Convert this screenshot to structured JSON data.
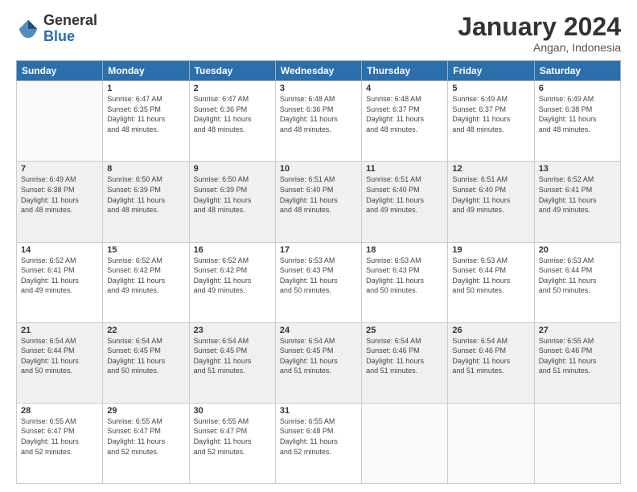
{
  "logo": {
    "general": "General",
    "blue": "Blue"
  },
  "header": {
    "month": "January 2024",
    "location": "Angan, Indonesia"
  },
  "weekdays": [
    "Sunday",
    "Monday",
    "Tuesday",
    "Wednesday",
    "Thursday",
    "Friday",
    "Saturday"
  ],
  "rows": [
    [
      {
        "day": "",
        "empty": true
      },
      {
        "day": "1",
        "sunrise": "Sunrise: 6:47 AM",
        "sunset": "Sunset: 6:35 PM",
        "daylight": "Daylight: 11 hours and 48 minutes."
      },
      {
        "day": "2",
        "sunrise": "Sunrise: 6:47 AM",
        "sunset": "Sunset: 6:36 PM",
        "daylight": "Daylight: 11 hours and 48 minutes."
      },
      {
        "day": "3",
        "sunrise": "Sunrise: 6:48 AM",
        "sunset": "Sunset: 6:36 PM",
        "daylight": "Daylight: 11 hours and 48 minutes."
      },
      {
        "day": "4",
        "sunrise": "Sunrise: 6:48 AM",
        "sunset": "Sunset: 6:37 PM",
        "daylight": "Daylight: 11 hours and 48 minutes."
      },
      {
        "day": "5",
        "sunrise": "Sunrise: 6:49 AM",
        "sunset": "Sunset: 6:37 PM",
        "daylight": "Daylight: 11 hours and 48 minutes."
      },
      {
        "day": "6",
        "sunrise": "Sunrise: 6:49 AM",
        "sunset": "Sunset: 6:38 PM",
        "daylight": "Daylight: 11 hours and 48 minutes."
      }
    ],
    [
      {
        "day": "7",
        "sunrise": "Sunrise: 6:49 AM",
        "sunset": "Sunset: 6:38 PM",
        "daylight": "Daylight: 11 hours and 48 minutes."
      },
      {
        "day": "8",
        "sunrise": "Sunrise: 6:50 AM",
        "sunset": "Sunset: 6:39 PM",
        "daylight": "Daylight: 11 hours and 48 minutes."
      },
      {
        "day": "9",
        "sunrise": "Sunrise: 6:50 AM",
        "sunset": "Sunset: 6:39 PM",
        "daylight": "Daylight: 11 hours and 48 minutes."
      },
      {
        "day": "10",
        "sunrise": "Sunrise: 6:51 AM",
        "sunset": "Sunset: 6:40 PM",
        "daylight": "Daylight: 11 hours and 48 minutes."
      },
      {
        "day": "11",
        "sunrise": "Sunrise: 6:51 AM",
        "sunset": "Sunset: 6:40 PM",
        "daylight": "Daylight: 11 hours and 49 minutes."
      },
      {
        "day": "12",
        "sunrise": "Sunrise: 6:51 AM",
        "sunset": "Sunset: 6:40 PM",
        "daylight": "Daylight: 11 hours and 49 minutes."
      },
      {
        "day": "13",
        "sunrise": "Sunrise: 6:52 AM",
        "sunset": "Sunset: 6:41 PM",
        "daylight": "Daylight: 11 hours and 49 minutes."
      }
    ],
    [
      {
        "day": "14",
        "sunrise": "Sunrise: 6:52 AM",
        "sunset": "Sunset: 6:41 PM",
        "daylight": "Daylight: 11 hours and 49 minutes."
      },
      {
        "day": "15",
        "sunrise": "Sunrise: 6:52 AM",
        "sunset": "Sunset: 6:42 PM",
        "daylight": "Daylight: 11 hours and 49 minutes."
      },
      {
        "day": "16",
        "sunrise": "Sunrise: 6:52 AM",
        "sunset": "Sunset: 6:42 PM",
        "daylight": "Daylight: 11 hours and 49 minutes."
      },
      {
        "day": "17",
        "sunrise": "Sunrise: 6:53 AM",
        "sunset": "Sunset: 6:43 PM",
        "daylight": "Daylight: 11 hours and 50 minutes."
      },
      {
        "day": "18",
        "sunrise": "Sunrise: 6:53 AM",
        "sunset": "Sunset: 6:43 PM",
        "daylight": "Daylight: 11 hours and 50 minutes."
      },
      {
        "day": "19",
        "sunrise": "Sunrise: 6:53 AM",
        "sunset": "Sunset: 6:44 PM",
        "daylight": "Daylight: 11 hours and 50 minutes."
      },
      {
        "day": "20",
        "sunrise": "Sunrise: 6:53 AM",
        "sunset": "Sunset: 6:44 PM",
        "daylight": "Daylight: 11 hours and 50 minutes."
      }
    ],
    [
      {
        "day": "21",
        "sunrise": "Sunrise: 6:54 AM",
        "sunset": "Sunset: 6:44 PM",
        "daylight": "Daylight: 11 hours and 50 minutes."
      },
      {
        "day": "22",
        "sunrise": "Sunrise: 6:54 AM",
        "sunset": "Sunset: 6:45 PM",
        "daylight": "Daylight: 11 hours and 50 minutes."
      },
      {
        "day": "23",
        "sunrise": "Sunrise: 6:54 AM",
        "sunset": "Sunset: 6:45 PM",
        "daylight": "Daylight: 11 hours and 51 minutes."
      },
      {
        "day": "24",
        "sunrise": "Sunrise: 6:54 AM",
        "sunset": "Sunset: 6:45 PM",
        "daylight": "Daylight: 11 hours and 51 minutes."
      },
      {
        "day": "25",
        "sunrise": "Sunrise: 6:54 AM",
        "sunset": "Sunset: 6:46 PM",
        "daylight": "Daylight: 11 hours and 51 minutes."
      },
      {
        "day": "26",
        "sunrise": "Sunrise: 6:54 AM",
        "sunset": "Sunset: 6:46 PM",
        "daylight": "Daylight: 11 hours and 51 minutes."
      },
      {
        "day": "27",
        "sunrise": "Sunrise: 6:55 AM",
        "sunset": "Sunset: 6:46 PM",
        "daylight": "Daylight: 11 hours and 51 minutes."
      }
    ],
    [
      {
        "day": "28",
        "sunrise": "Sunrise: 6:55 AM",
        "sunset": "Sunset: 6:47 PM",
        "daylight": "Daylight: 11 hours and 52 minutes."
      },
      {
        "day": "29",
        "sunrise": "Sunrise: 6:55 AM",
        "sunset": "Sunset: 6:47 PM",
        "daylight": "Daylight: 11 hours and 52 minutes."
      },
      {
        "day": "30",
        "sunrise": "Sunrise: 6:55 AM",
        "sunset": "Sunset: 6:47 PM",
        "daylight": "Daylight: 11 hours and 52 minutes."
      },
      {
        "day": "31",
        "sunrise": "Sunrise: 6:55 AM",
        "sunset": "Sunset: 6:48 PM",
        "daylight": "Daylight: 11 hours and 52 minutes."
      },
      {
        "day": "",
        "empty": true
      },
      {
        "day": "",
        "empty": true
      },
      {
        "day": "",
        "empty": true
      }
    ]
  ]
}
